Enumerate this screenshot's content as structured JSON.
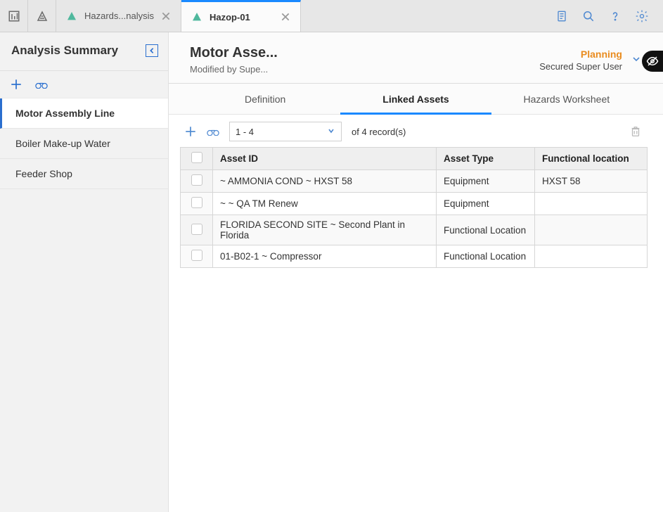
{
  "topbar": {
    "tabs": [
      {
        "label": "Hazards...nalysis",
        "active": false
      },
      {
        "label": "Hazop-01",
        "active": true
      }
    ]
  },
  "sidebar": {
    "title": "Analysis Summary",
    "items": [
      {
        "label": "Motor Assembly Line",
        "selected": true
      },
      {
        "label": "Boiler Make-up Water",
        "selected": false
      },
      {
        "label": "Feeder Shop",
        "selected": false
      }
    ]
  },
  "main": {
    "title": "Motor Asse...",
    "subtitle": "Modified by Supe...",
    "status_label": "Planning",
    "user_label": "Secured Super User"
  },
  "secondary_tabs": [
    {
      "label": "Definition",
      "active": false
    },
    {
      "label": "Linked Assets",
      "active": true
    },
    {
      "label": "Hazards Worksheet",
      "active": false
    }
  ],
  "pager": {
    "range": "1 - 4",
    "of_label": "of",
    "total": "4",
    "records_label": "record(s)"
  },
  "table": {
    "headers": [
      "Asset ID",
      "Asset Type",
      "Functional location"
    ],
    "rows": [
      {
        "asset_id": "~ AMMONIA COND ~ HXST 58",
        "asset_type": "Equipment",
        "func_loc": "HXST 58"
      },
      {
        "asset_id": "~ ~ QA TM Renew",
        "asset_type": "Equipment",
        "func_loc": ""
      },
      {
        "asset_id": "FLORIDA SECOND SITE ~ Second Plant in Florida",
        "asset_type": "Functional Location",
        "func_loc": ""
      },
      {
        "asset_id": "01-B02-1 ~ Compressor",
        "asset_type": "Functional Location",
        "func_loc": ""
      }
    ]
  }
}
